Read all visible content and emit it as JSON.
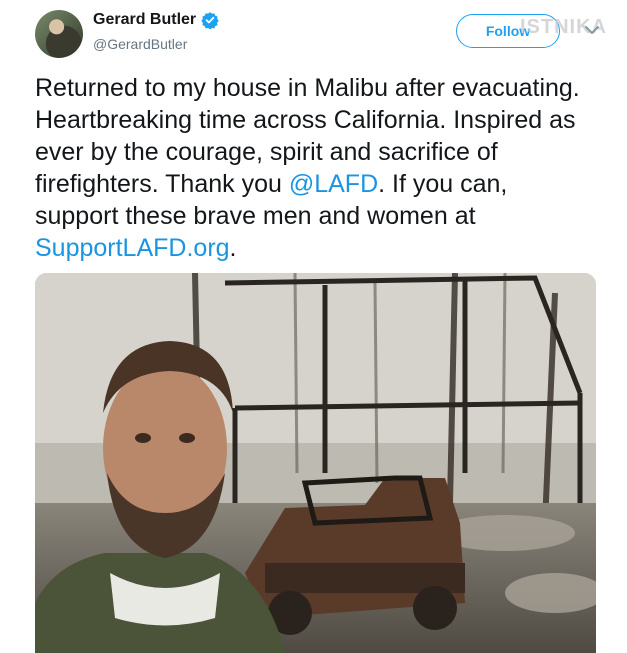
{
  "tweet": {
    "author": {
      "display_name": "Gerard Butler",
      "handle": "@GerardButler",
      "verified": true
    },
    "follow_label": "Follow",
    "watermark": "ISTNIKA",
    "text_parts": [
      "Returned to my house in Malibu after evacuating. Heartbreaking time across California. Inspired as ever by the courage, spirit and sacrifice of firefighters. Thank you ",
      "@LAFD",
      ". If you can, support these brave men and women at ",
      "SupportLAFD.org",
      "."
    ]
  },
  "colors": {
    "accent": "#1da1f2",
    "link": "#1b95e0",
    "text": "#14171a",
    "muted": "#657786"
  },
  "icons": [
    "verified-badge-icon",
    "chevron-down-icon"
  ]
}
